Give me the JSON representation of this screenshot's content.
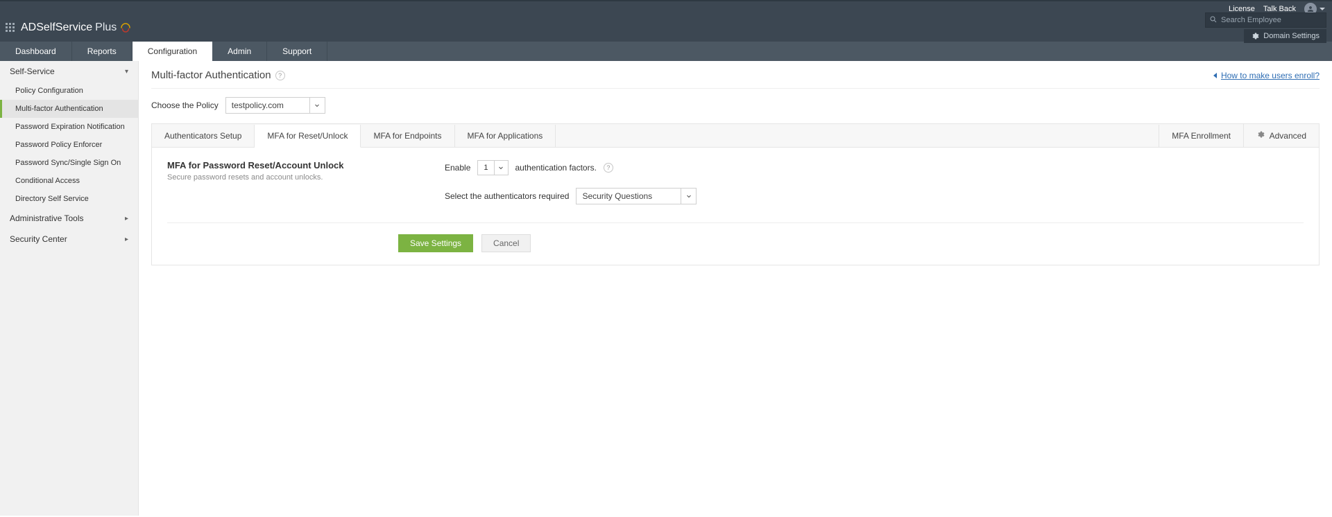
{
  "header": {
    "license": "License",
    "talkback": "Talk Back",
    "brand_main": "ADSelfService",
    "brand_plus": "Plus",
    "search_placeholder": "Search Employee",
    "domain_settings": "Domain Settings"
  },
  "tabs": {
    "dashboard": "Dashboard",
    "reports": "Reports",
    "configuration": "Configuration",
    "admin": "Admin",
    "support": "Support"
  },
  "sidebar": {
    "self_service": "Self-Service",
    "items": [
      "Policy Configuration",
      "Multi-factor Authentication",
      "Password Expiration Notification",
      "Password Policy Enforcer",
      "Password Sync/Single Sign On",
      "Conditional Access",
      "Directory Self Service"
    ],
    "admin_tools": "Administrative Tools",
    "security_center": "Security Center"
  },
  "page": {
    "title": "Multi-factor Authentication",
    "how_link": "How to make users enroll?",
    "choose_policy_label": "Choose the Policy",
    "policy_value": "testpolicy.com"
  },
  "inner_tabs": {
    "auth_setup": "Authenticators Setup",
    "reset": "MFA for Reset/Unlock",
    "endpoints": "MFA for Endpoints",
    "apps": "MFA for Applications",
    "enrollment": "MFA Enrollment",
    "advanced": "Advanced"
  },
  "panel": {
    "heading": "MFA for Password Reset/Account Unlock",
    "sub": "Secure password resets and account unlocks.",
    "enable_label": "Enable",
    "enable_value": "1",
    "enable_suffix": "authentication factors.",
    "select_auth_label": "Select the authenticators required",
    "auth_value": "Security Questions",
    "save": "Save Settings",
    "cancel": "Cancel"
  }
}
